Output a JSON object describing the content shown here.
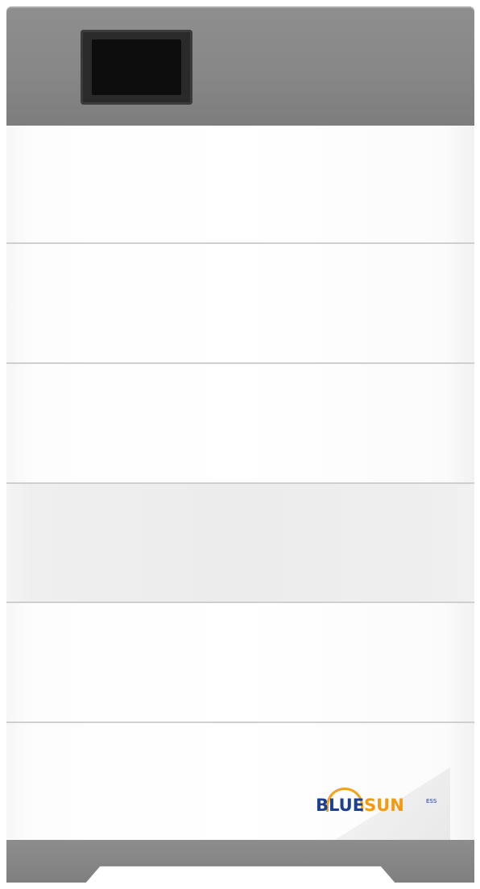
{
  "product": {
    "brand_logo": {
      "prefix": "BLUE",
      "suffix": "SUN",
      "tag": "ESS"
    },
    "colors": {
      "cap_gray": "#868686",
      "module_white": "#fdfdfd",
      "screen_black": "#0d0d0d",
      "logo_blue": "#1d3f8f",
      "logo_orange": "#f29a12"
    },
    "module_count": 6
  }
}
